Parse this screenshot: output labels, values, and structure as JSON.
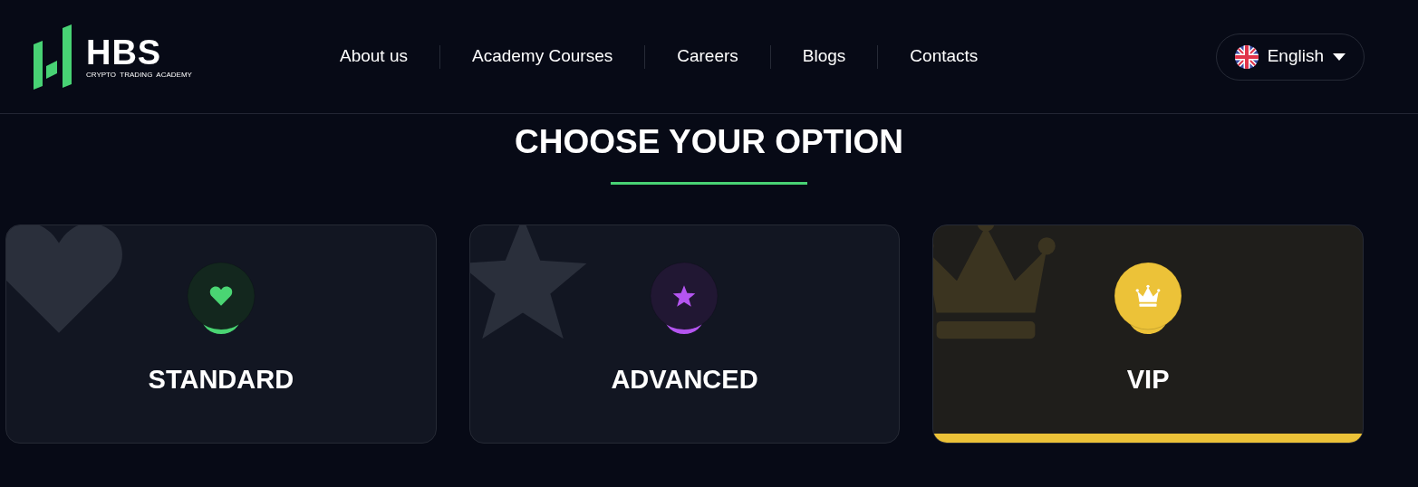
{
  "logo": {
    "title": "HBS",
    "subtitle": "CRYPTO  TRADING  ACADEMY"
  },
  "nav": [
    {
      "label": "About us"
    },
    {
      "label": "Academy Courses"
    },
    {
      "label": "Careers"
    },
    {
      "label": "Blogs"
    },
    {
      "label": "Contacts"
    }
  ],
  "language": {
    "label": "English"
  },
  "heading": "CHOOSE YOUR OPTION",
  "options": [
    {
      "kind": "heart",
      "name": "STANDARD",
      "color": "#4ad573",
      "selected": false
    },
    {
      "kind": "star",
      "name": "ADVANCED",
      "color": "#b455f0",
      "selected": false
    },
    {
      "kind": "crown",
      "name": "VIP",
      "color": "#ecc238",
      "selected": true
    }
  ]
}
